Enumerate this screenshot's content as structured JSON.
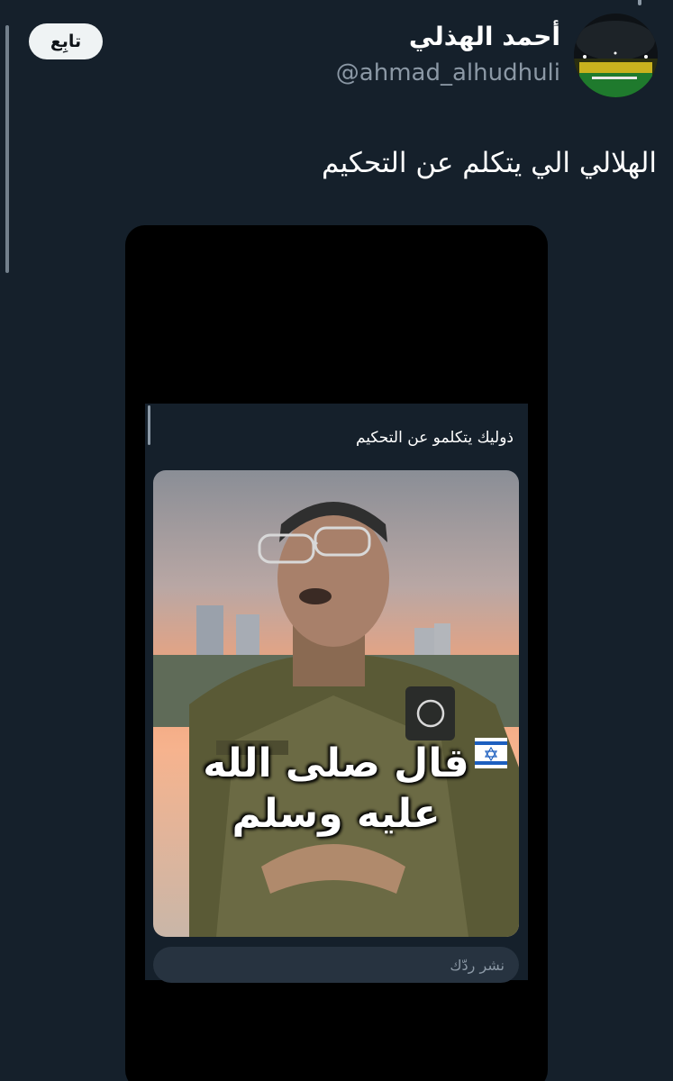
{
  "author": {
    "display_name": "أحمد الهذلي",
    "handle": "@ahmad_alhudhuli"
  },
  "follow_label": "تابِع",
  "tweet": {
    "text": "الهلالي الي يتكلم عن التحكيم"
  },
  "embedded_screenshot": {
    "caption": "ذوليك يتكلمو عن التحكيم",
    "video_subtitles": [
      "قال صلى الله",
      "عليه وسلم"
    ],
    "reply_placeholder": "نشر ردّك"
  },
  "colors": {
    "background": "#15202b",
    "text_primary": "#ffffff",
    "text_secondary": "#8b98a5",
    "button_bg": "#eff3f4"
  }
}
